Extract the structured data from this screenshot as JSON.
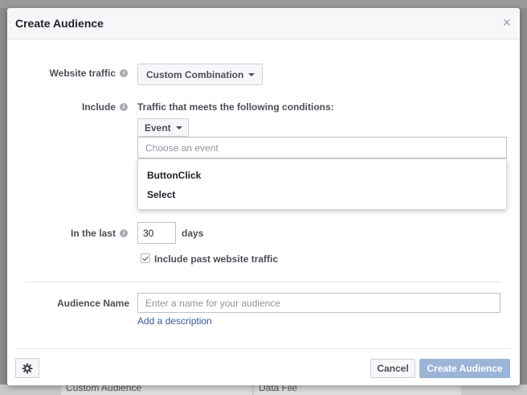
{
  "background": {
    "cell_1": "Custom Audience",
    "cell_2": "Data File"
  },
  "dialog": {
    "title": "Create Audience",
    "close_glyph": "×"
  },
  "website_traffic": {
    "label": "Website traffic",
    "value": "Custom Combination"
  },
  "include": {
    "label": "Include",
    "conditions_text": "Traffic that meets the following conditions:",
    "event_button": "Event",
    "event_input_placeholder": "Choose an event",
    "dropdown_options": [
      "ButtonClick",
      "Select"
    ]
  },
  "in_the_last": {
    "label": "In the last",
    "value": "30",
    "unit": "days"
  },
  "past_traffic": {
    "label": "Include past website traffic",
    "checked": true
  },
  "audience_name": {
    "label": "Audience Name",
    "placeholder": "Enter a name for your audience",
    "add_description": "Add a description"
  },
  "footer": {
    "cancel": "Cancel",
    "create": "Create Audience",
    "settings_icon": "gear-icon"
  },
  "colors": {
    "primary_disabled": "#9cb4d8",
    "link": "#365899",
    "header_bg": "#f6f7f9"
  }
}
